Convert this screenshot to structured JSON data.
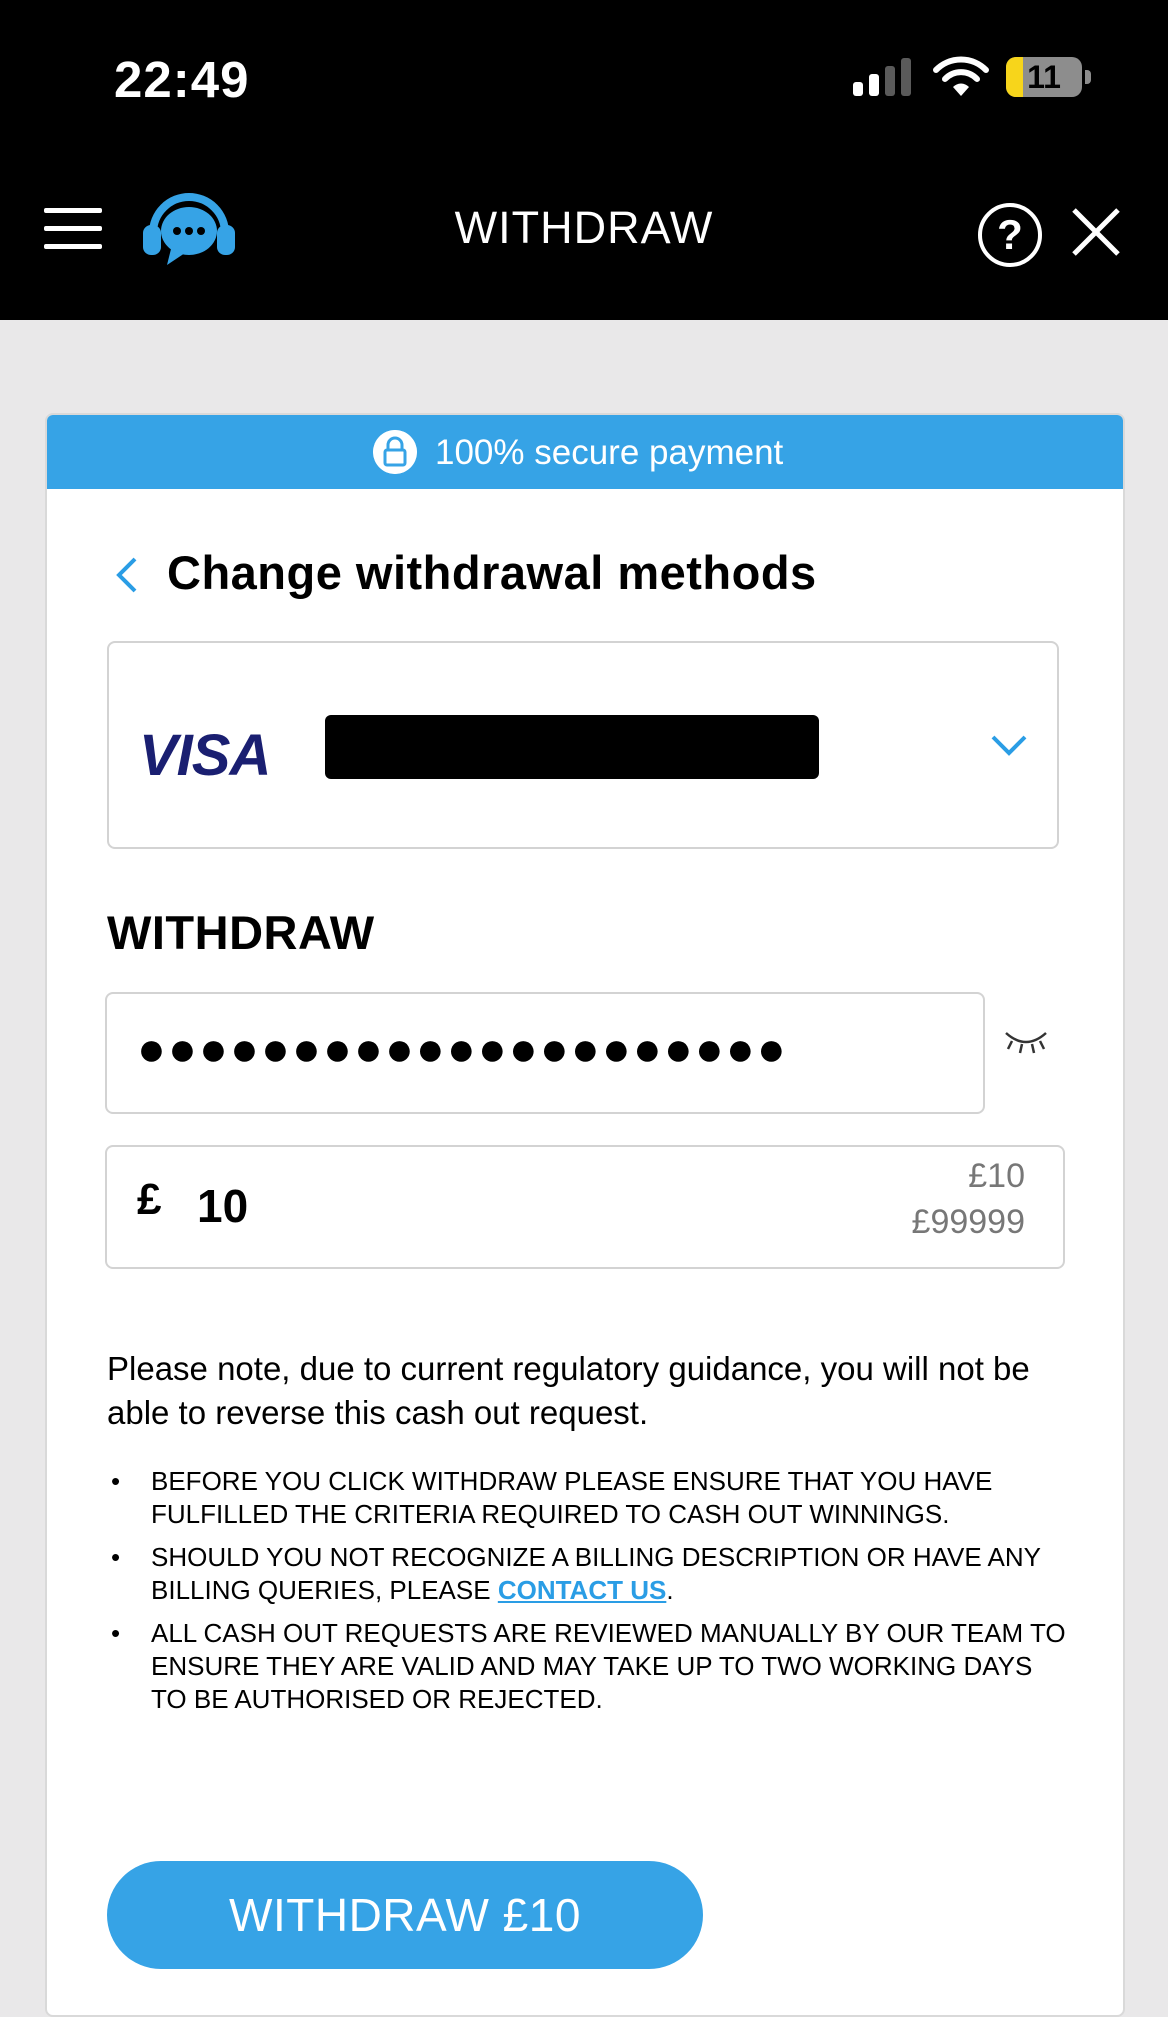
{
  "status_bar": {
    "time": "22:49",
    "battery_level": "11",
    "battery_color": "#f7d51b",
    "icons": [
      "signal-icon",
      "wifi-icon",
      "battery-icon"
    ]
  },
  "header": {
    "title": "WITHDRAW",
    "icons": [
      "menu-icon",
      "support-chat-icon",
      "help-icon",
      "close-icon"
    ],
    "background": "#000000"
  },
  "secure_banner": {
    "text": "100% secure payment",
    "icon": "lock-icon",
    "color": "#36a3e6"
  },
  "back_link": {
    "text": "Change withdrawal methods",
    "icon": "chevron-left-icon"
  },
  "payment_method": {
    "brand": "VISA",
    "brand_color": "#1a1f71",
    "icon": "chevron-down-icon"
  },
  "withdraw_section": {
    "title": "WITHDRAW",
    "password_mask": "●●●●●●●●●●●●●●●●●●●●●",
    "eye_icon": "eye-closed-icon",
    "currency_symbol": "£",
    "amount_value": "10",
    "min_limit": "£10",
    "max_limit": "£99999"
  },
  "note": "Please note, due to current regulatory guidance, you will not be able to reverse this cash out request.",
  "rules": {
    "item1": "Before you click withdraw please ensure that you have fulfilled the criteria required to cash out winnings.",
    "item2_before": "Should you not recognize a billing description or have any billing queries, please ",
    "item2_link": "CONTACT US",
    "item2_after": ".",
    "item3": "All cash out requests are reviewed manually by our team to ensure they are valid and may take up to two working days to be authorised or rejected."
  },
  "submit_button": {
    "label": "WITHDRAW £10",
    "color": "#36a3e6"
  }
}
